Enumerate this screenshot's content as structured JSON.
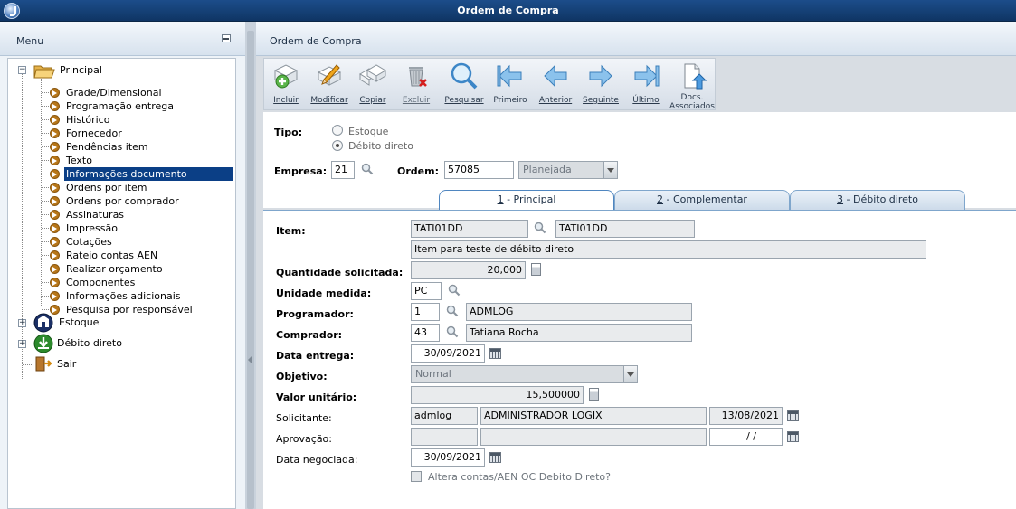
{
  "window": {
    "title": "Ordem de Compra"
  },
  "menu": {
    "header": "Menu",
    "root_principal": "Principal",
    "items": [
      "Grade/Dimensional",
      "Programação entrega",
      "Histórico",
      "Fornecedor",
      "Pendências item",
      "Texto",
      "Informações documento",
      "Ordens por item",
      "Ordens por comprador",
      "Assinaturas",
      "Impressão",
      "Cotações",
      "Rateio contas AEN",
      "Realizar orçamento",
      "Componentes",
      "Informações adicionais",
      "Pesquisa por responsável"
    ],
    "selected_index": 6,
    "root_estoque": "Estoque",
    "root_debito": "Débito direto",
    "root_sair": "Sair"
  },
  "panel": {
    "title": "Ordem de Compra"
  },
  "toolbar": {
    "incluir": "Incluir",
    "modificar": "Modificar",
    "copiar": "Copiar",
    "excluir": "Excluir",
    "pesquisar": "Pesquisar",
    "primeiro": "Primeiro",
    "anterior": "Anterior",
    "seguinte": "Seguinte",
    "ultimo": "Último",
    "docs_line1": "Docs.",
    "docs_line2": "Associados"
  },
  "header_form": {
    "tipo_label": "Tipo:",
    "tipo_options": [
      "Estoque",
      "Débito direto"
    ],
    "tipo_selected": "Débito direto",
    "empresa_label": "Empresa:",
    "empresa_value": "21",
    "ordem_label": "Ordem:",
    "ordem_value": "57085",
    "status_value": "Planejada"
  },
  "tabs": [
    {
      "num": "1",
      "label": " - Principal"
    },
    {
      "num": "2",
      "label": " - Complementar"
    },
    {
      "num": "3",
      "label": " - Débito direto"
    }
  ],
  "active_tab": 0,
  "form": {
    "item_label": "Item:",
    "item_code": "TATI01DD",
    "item_code2": "TATI01DD",
    "item_desc": "Item para teste de débito direto",
    "qtd_label": "Quantidade solicitada:",
    "qtd_value": "20,000",
    "unidade_label": "Unidade medida:",
    "unidade_value": "PC",
    "programador_label": "Programador:",
    "programador_code": "1",
    "programador_name": "ADMLOG",
    "comprador_label": "Comprador:",
    "comprador_code": "43",
    "comprador_name": "Tatiana Rocha",
    "data_entrega_label": "Data entrega:",
    "data_entrega_value": "30/09/2021",
    "objetivo_label": "Objetivo:",
    "objetivo_value": "Normal",
    "valor_label": "Valor unitário:",
    "valor_value": "15,500000",
    "solicitante_label": "Solicitante:",
    "solicitante_user": "admlog",
    "solicitante_name": "ADMINISTRADOR LOGIX",
    "solicitante_date": "13/08/2021",
    "aprovacao_label": "Aprovação:",
    "aprovacao_user": "",
    "aprovacao_name": "",
    "aprovacao_date": " / /",
    "data_negociada_label": "Data negociada:",
    "data_negociada_value": "30/09/2021",
    "altera_label": "Altera contas/AEN OC Debito Direto?"
  }
}
